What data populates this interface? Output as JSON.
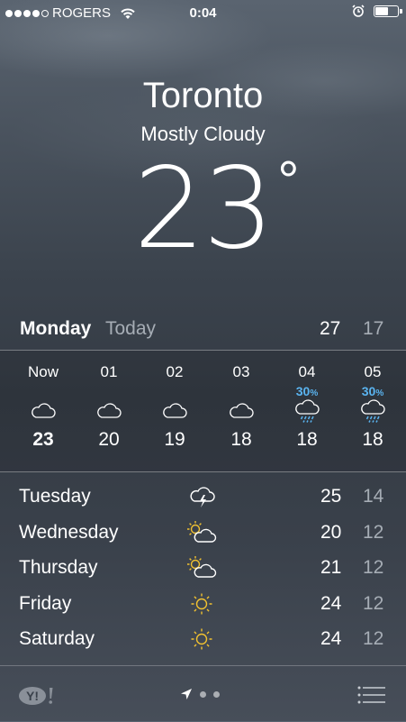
{
  "status": {
    "carrier": "ROGERS",
    "time": "0:04",
    "signal_icon": "signal-dots-icon",
    "wifi_icon": "wifi-icon",
    "alarm_icon": "alarm-clock-icon",
    "battery_icon": "battery-icon",
    "battery_level": 0.55
  },
  "location": {
    "city": "Toronto",
    "condition": "Mostly Cloudy",
    "temperature": "23",
    "degree": "°"
  },
  "today": {
    "day": "Monday",
    "label": "Today",
    "high": "27",
    "low": "17"
  },
  "hourly": [
    {
      "time": "Now",
      "precip": "",
      "icon": "cloud-icon",
      "temp": "23",
      "bold": true
    },
    {
      "time": "01",
      "precip": "",
      "icon": "cloud-icon",
      "temp": "20"
    },
    {
      "time": "02",
      "precip": "",
      "icon": "cloud-icon",
      "temp": "19"
    },
    {
      "time": "03",
      "precip": "",
      "icon": "cloud-icon",
      "temp": "18"
    },
    {
      "time": "04",
      "precip": "30",
      "precip_unit": "%",
      "icon": "rain-cloud-icon",
      "temp": "18"
    },
    {
      "time": "05",
      "precip": "30",
      "precip_unit": "%",
      "icon": "rain-cloud-icon",
      "temp": "18"
    }
  ],
  "daily": [
    {
      "day": "Tuesday",
      "icon": "thunderstorm-icon",
      "high": "25",
      "low": "14"
    },
    {
      "day": "Wednesday",
      "icon": "partly-cloudy-icon",
      "high": "20",
      "low": "12"
    },
    {
      "day": "Thursday",
      "icon": "partly-cloudy-icon",
      "high": "21",
      "low": "12"
    },
    {
      "day": "Friday",
      "icon": "sun-icon",
      "high": "24",
      "low": "12"
    },
    {
      "day": "Saturday",
      "icon": "sun-icon",
      "high": "24",
      "low": "12"
    }
  ],
  "bottom": {
    "logo": "Y!",
    "location_icon": "location-arrow-icon",
    "list_icon": "list-icon"
  },
  "colors": {
    "precip": "#5ab4f0",
    "sun": "#f2c230",
    "secondary_text": "#a6adb5"
  }
}
